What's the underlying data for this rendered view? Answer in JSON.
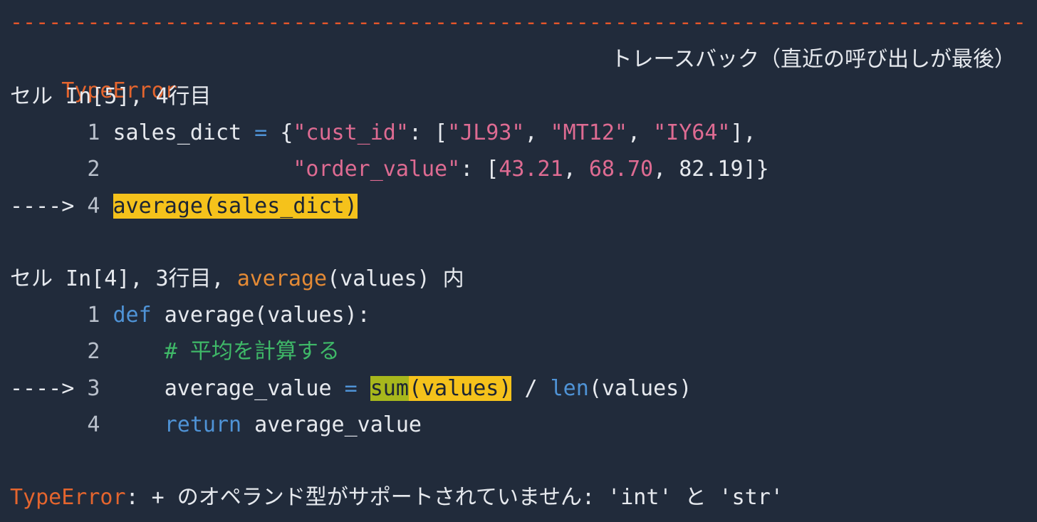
{
  "header": {
    "rule": "--------------------------------------------------------------------------------------------------------------------------------",
    "error_name": "TypeError",
    "traceback_title": "トレースバック（直近の呼び出しが最後）"
  },
  "frame1": {
    "location": "セル In[5], 4行目",
    "lines": [
      {
        "marker": "      ",
        "lineno": "1",
        "t1": "sales_dict",
        "t2": " = ",
        "t3": "{",
        "t4": "\"cust_id\"",
        "t5": ": [",
        "t6": "\"JL93\"",
        "t7": ", ",
        "t8": "\"MT12\"",
        "t9": ", ",
        "t10": "\"IY64\"",
        "t11": "],"
      },
      {
        "marker": "      ",
        "lineno": "2",
        "indent": "              ",
        "t1": "\"order_value\"",
        "t2": ": [",
        "t3": "43.21",
        "t4": ", ",
        "t5": "68.70",
        "t6": ", ",
        "t7": "82.19",
        "t8": "]}"
      },
      {
        "marker": "----> ",
        "lineno": "4",
        "code": "average(sales_dict)"
      }
    ]
  },
  "frame2": {
    "loc_prefix": "セル In[4], 3行目, ",
    "loc_func": "average",
    "loc_suffix": "(values) 内",
    "lines": [
      {
        "marker": "      ",
        "lineno": "1",
        "kw": "def",
        "rest": " average(values):"
      },
      {
        "marker": "      ",
        "lineno": "2",
        "indent": "    ",
        "comment": "# 平均を計算する"
      },
      {
        "marker": "----> ",
        "lineno": "3",
        "indent": "    ",
        "a": "average_value",
        "eq": " = ",
        "hl_sum": "sum",
        "hl_args": "(values)",
        "div": " / ",
        "len_fn": "len",
        "len_args": "(values)"
      },
      {
        "marker": "      ",
        "lineno": "4",
        "indent": "    ",
        "kw": "return",
        "rest": " average_value"
      }
    ]
  },
  "error_message": {
    "name": "TypeError",
    "text": ": + のオペランド型がサポートされていません: 'int' と 'str'"
  }
}
